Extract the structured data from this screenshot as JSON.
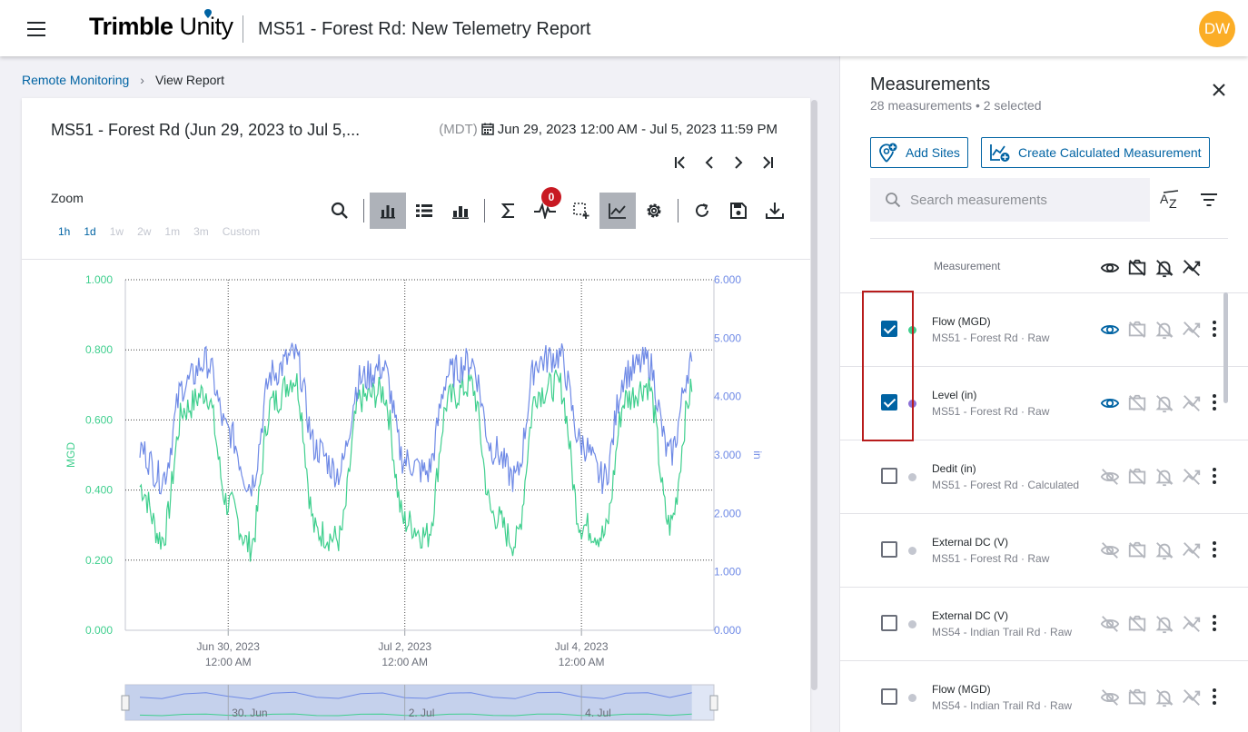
{
  "header": {
    "logo_primary": "Trimble",
    "logo_secondary": " Unity",
    "title": "MS51 - Forest Rd: New Telemetry Report",
    "avatar_initials": "DW",
    "avatar_color": "#fbad26"
  },
  "breadcrumb": {
    "parent": "Remote Monitoring",
    "current": "View Report"
  },
  "report": {
    "title": "MS51 - Forest Rd (Jun 29, 2023 to Jul 5,...",
    "timezone": "(MDT)",
    "date_range": "Jun 29, 2023 12:00 AM - Jul 5, 2023 11:59 PM",
    "zoom_label": "Zoom",
    "zoom_options": [
      {
        "label": "1h",
        "enabled": true
      },
      {
        "label": "1d",
        "enabled": true
      },
      {
        "label": "1w",
        "enabled": false
      },
      {
        "label": "2w",
        "enabled": false
      },
      {
        "label": "1m",
        "enabled": false
      },
      {
        "label": "3m",
        "enabled": false
      },
      {
        "label": "Custom",
        "enabled": false
      }
    ],
    "alarm_badge": "0",
    "toolbar_icons": [
      "search-icon",
      "bar-chart-icon",
      "list-icon",
      "stacked-bar-icon",
      "sigma-icon",
      "pulse-icon",
      "select-region-icon",
      "line-chart-icon",
      "gear-icon",
      "refresh-icon",
      "save-icon",
      "download-icon"
    ]
  },
  "chart_data": {
    "type": "line",
    "x_range": [
      "2023-06-29 00:00",
      "2023-07-05 00:00"
    ],
    "x_ticks": [
      {
        "date": "Jun 30, 2023",
        "time": "12:00 AM"
      },
      {
        "date": "Jul 2, 2023",
        "time": "12:00 AM"
      },
      {
        "date": "Jul 4, 2023",
        "time": "12:00 AM"
      }
    ],
    "ylabel_left": "MGD",
    "ylabel_right": "in",
    "ylim_left": [
      0,
      1
    ],
    "ylim_right": [
      0,
      6
    ],
    "yticks_left": [
      "1.000",
      "0.800",
      "0.600",
      "0.400",
      "0.200",
      "0.000"
    ],
    "yticks_right": [
      "6.000",
      "5.000",
      "4.000",
      "3.000",
      "2.000",
      "1.000",
      "0.000"
    ],
    "grid": true,
    "navigator_labels": [
      "30. Jun",
      "2. Jul",
      "4. Jul"
    ],
    "series": [
      {
        "name": "Flow (MGD)",
        "axis": "left",
        "color": "#3fcf8e",
        "x_hours": [
          0,
          6,
          12,
          18,
          24,
          30,
          36,
          42,
          48,
          54,
          60,
          66,
          72,
          78,
          84,
          90,
          96,
          102,
          108,
          114,
          120,
          126,
          132,
          138,
          144,
          150
        ],
        "values": [
          0.41,
          0.26,
          0.63,
          0.68,
          0.36,
          0.24,
          0.65,
          0.72,
          0.28,
          0.26,
          0.66,
          0.68,
          0.31,
          0.27,
          0.66,
          0.7,
          0.33,
          0.25,
          0.68,
          0.7,
          0.3,
          0.27,
          0.66,
          0.7,
          0.3,
          0.68
        ]
      },
      {
        "name": "Level (in)",
        "axis": "right",
        "color": "#6f8ae6",
        "x_hours": [
          0,
          6,
          12,
          18,
          24,
          30,
          36,
          42,
          48,
          54,
          60,
          66,
          72,
          78,
          84,
          90,
          96,
          102,
          108,
          114,
          120,
          126,
          132,
          138,
          144,
          150
        ],
        "values": [
          3.1,
          2.6,
          4.2,
          4.6,
          3.4,
          2.5,
          4.4,
          4.7,
          3.1,
          2.7,
          4.3,
          4.5,
          2.9,
          2.7,
          4.4,
          4.6,
          3.1,
          2.6,
          4.6,
          4.7,
          3.2,
          2.6,
          4.4,
          4.6,
          3.0,
          4.6
        ]
      }
    ]
  },
  "panel": {
    "title": "Measurements",
    "subtitle": "28 measurements • 2 selected",
    "add_sites_label": "Add Sites",
    "create_calc_label": "Create Calculated Measurement",
    "search_placeholder": "Search measurements",
    "column_header": "Measurement",
    "rows": [
      {
        "name": "Flow (MGD)",
        "sub": "MS51 - Forest Rd · Raw",
        "checked": true,
        "dot": "#3fcf8e",
        "visible": true
      },
      {
        "name": "Level (in)",
        "sub": "MS51 - Forest Rd · Raw",
        "checked": true,
        "dot": "#8c70d6",
        "visible": true
      },
      {
        "name": "Dedit (in)",
        "sub": "MS51 - Forest Rd · Calculated",
        "checked": false,
        "dot": "#c4c7d0",
        "visible": false
      },
      {
        "name": "External DC (V)",
        "sub": "MS51 - Forest Rd · Raw",
        "checked": false,
        "dot": "#c4c7d0",
        "visible": false
      },
      {
        "name": "External DC (V)",
        "sub": "MS54 - Indian Trail Rd · Raw",
        "checked": false,
        "dot": "#c4c7d0",
        "visible": false
      },
      {
        "name": "Flow (MGD)",
        "sub": "MS54 - Indian Trail Rd · Raw",
        "checked": false,
        "dot": "#c4c7d0",
        "visible": false
      }
    ]
  }
}
